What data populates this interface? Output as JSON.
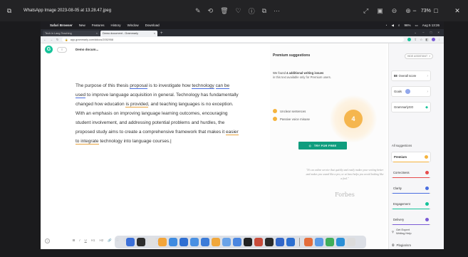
{
  "viewer": {
    "title": "WhatsApp Image 2023-08-05 at 13.28.47.jpeg",
    "zoom": "73%"
  },
  "mac": {
    "app_name": "Safari Browser",
    "menu": [
      "New",
      "Features",
      "History",
      "Window",
      "Download"
    ],
    "status_battery": "96%",
    "status_datetime": "Aug 5 13:26"
  },
  "browser": {
    "tabs": [
      {
        "label": "Tech in Lang Teaching",
        "active": false
      },
      {
        "label": "Demo document - Grammarly",
        "active": true
      }
    ],
    "url": "app.grammarly.com/ddocs/2052958"
  },
  "doc": {
    "title": "Demo docum...",
    "word_count": "75 words",
    "paragraph": [
      {
        "text": "The purpose of this thesis ",
        "mark": ""
      },
      {
        "text": "proposal",
        "mark": "blue"
      },
      {
        "text": " is to investigate how ",
        "mark": ""
      },
      {
        "text": "technology",
        "mark": "blue"
      },
      {
        "text": " ",
        "mark": ""
      },
      {
        "text": "can be used",
        "mark": "blue"
      },
      {
        "text": " to improve language acquisition in general. Technology has fundamentally changed how education ",
        "mark": ""
      },
      {
        "text": "is provided",
        "mark": "orange"
      },
      {
        "text": ", and teaching languages is no exception. With an emphasis on improving language learning outcomes, encouraging student involvement, and addressing potential problems and hurdles, the proposed study aims to create a comprehensive framework that makes it ",
        "mark": ""
      },
      {
        "text": "easier to integrate",
        "mark": "orange"
      },
      {
        "text": " technology into language courses.",
        "mark": ""
      }
    ]
  },
  "premium": {
    "title": "Premium suggestions",
    "found_prefix": "We found ",
    "found_count": "4 additional writing issues",
    "subtext": "in this text available only for Premium users.",
    "issues": [
      "Unclear sentences",
      "Passive voice misuse"
    ],
    "count": "4",
    "cta": "TRY FOR FREE",
    "quote": "\"It's an online service that quickly and easily makes your writing better and makes you sound like a pro, or at least helps you avoid looking like a fool.\"",
    "source": "Forbes"
  },
  "sidebar": {
    "hide_label": "HIDE ASSISTANT",
    "score_value": "88",
    "score_label": "Overall score",
    "goals": "Goals",
    "go": "GrammarlyGO",
    "all_suggestions": "All suggestions",
    "categories": [
      {
        "label": "Premium",
        "color": "#f5b33d",
        "active": true
      },
      {
        "label": "Correctness",
        "color": "#e74c4c",
        "active": false
      },
      {
        "label": "Clarity",
        "color": "#4a6ee0",
        "active": false
      },
      {
        "label": "Engagement",
        "color": "#15c39a",
        "active": false
      },
      {
        "label": "Delivery",
        "color": "#7b5bd6",
        "active": false
      }
    ],
    "expert_line1": "Get Expert",
    "expert_line2": "Writing Help",
    "plagiarism": "Plagiarism"
  },
  "dock": {
    "apps": [
      "#3b6fd8",
      "#2d2d2d",
      "#e0e0e0",
      "#f2a53a",
      "#3f8be0",
      "#2f6fd2",
      "#4a90e2",
      "#3b7bd8",
      "#f0a73b",
      "#6aa3e8",
      "#4b86e0",
      "#222222",
      "#c84b3a",
      "#2a2a2a",
      "#3166c8",
      "#2c6fd0",
      "#e46d3a",
      "#5a9ae6",
      "#3fae5a",
      "#2a8fd6",
      "#dcdcdc"
    ]
  }
}
